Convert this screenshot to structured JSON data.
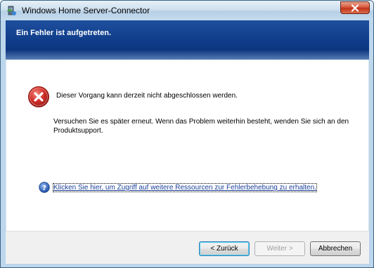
{
  "window": {
    "title": "Windows Home Server-Connector"
  },
  "banner": {
    "title": "Ein Fehler ist aufgetreten."
  },
  "content": {
    "error_message": "Dieser Vorgang kann derzeit nicht abgeschlossen werden.",
    "detail_message": "Versuchen Sie es später erneut. Wenn das Problem weiterhin besteht, wenden Sie sich an den Produktsupport.",
    "help_link": "Klicken Sie hier, um Zugriff auf weitere Ressourcen zur Fehlerbehebung zu erhalten."
  },
  "buttons": {
    "back": "< Zurück",
    "next": "Weiter >",
    "cancel": "Abbrechen"
  },
  "icons": {
    "app": "home-server-icon",
    "close": "close-icon",
    "error": "error-icon",
    "help": "help-icon"
  },
  "colors": {
    "banner": "#0e3a87",
    "link": "#1a3e9a",
    "error": "#c8262a",
    "close_button": "#c2331a"
  }
}
